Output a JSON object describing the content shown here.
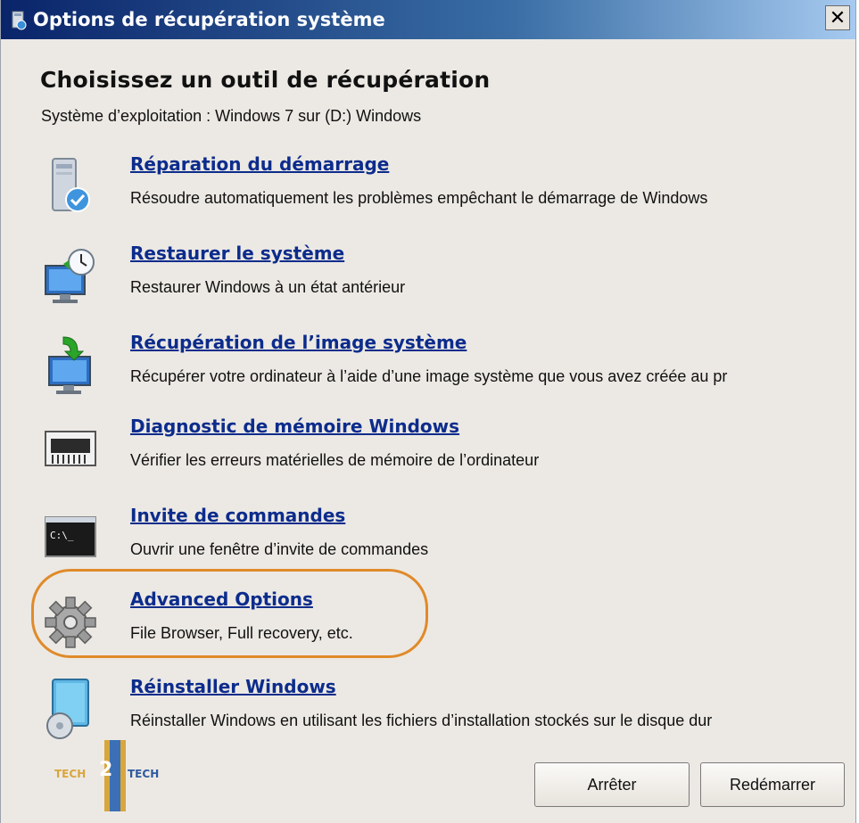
{
  "window": {
    "title": "Options de récupération système",
    "close_label": "✕"
  },
  "heading": "Choisissez un outil de récupération",
  "os_line": "Système d’exploitation : Windows 7 sur (D:) Windows",
  "tools": [
    {
      "icon": "startup-repair-icon",
      "label": "Réparation du démarrage",
      "description": "Résoudre automatiquement les problèmes empêchant le démarrage de Windows"
    },
    {
      "icon": "system-restore-icon",
      "label": "Restaurer le système",
      "description": "Restaurer Windows à un état antérieur"
    },
    {
      "icon": "system-image-icon",
      "label": "Récupération de l’image système",
      "description": "Récupérer votre ordinateur à l’aide d’une image système que vous avez créée au pr"
    },
    {
      "icon": "memory-chip-icon",
      "label": "Diagnostic de mémoire Windows",
      "description": "Vérifier les erreurs matérielles de mémoire de l’ordinateur"
    },
    {
      "icon": "command-prompt-icon",
      "label": "Invite de commandes",
      "description": "Ouvrir une fenêtre d’invite de commandes"
    },
    {
      "icon": "gear-icon",
      "label": "Advanced Options",
      "description": "File Browser, Full recovery, etc."
    },
    {
      "icon": "reinstall-windows-icon",
      "label": "Réinstaller Windows",
      "description": "Réinstaller Windows en utilisant les fichiers d’installation stockés sur le disque dur"
    }
  ],
  "buttons": {
    "shutdown": "Arrêter",
    "restart": "Redémarrer"
  },
  "logo": {
    "left_text": "TECH",
    "right_text": "TECH",
    "center": "2"
  },
  "colors": {
    "link": "#0c2c8c",
    "highlight": "#e08a2a",
    "title_bar": "#0a246a"
  }
}
